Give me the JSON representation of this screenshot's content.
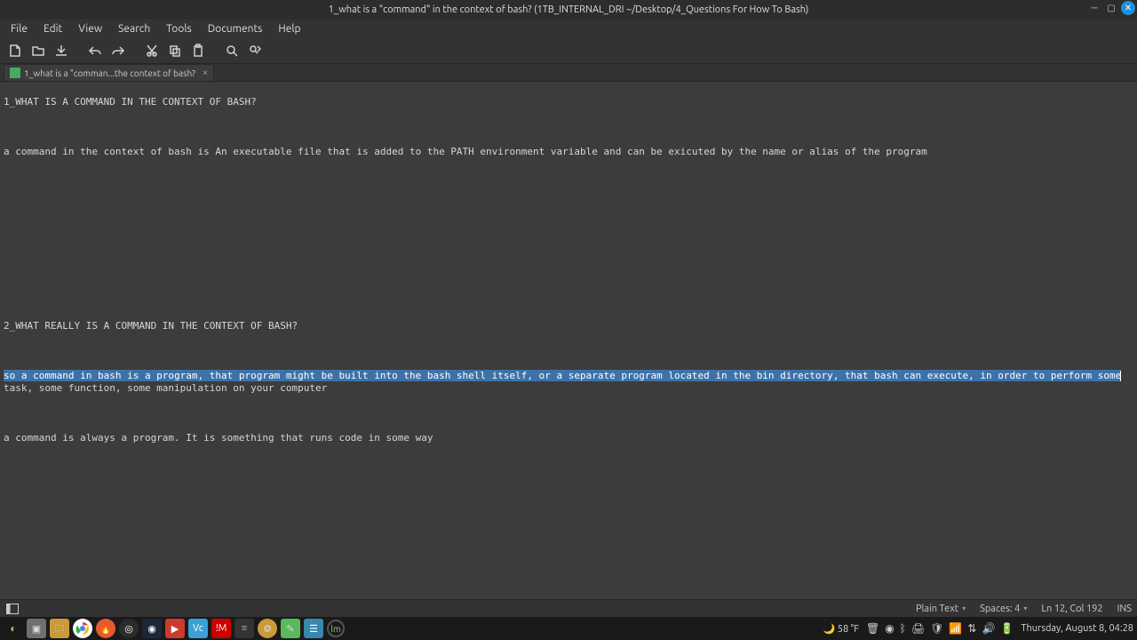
{
  "titlebar": {
    "title": "1_what is a \"command\" in the context of bash? (1TB_INTERNAL_DRI ~/Desktop/4_Questions For How To Bash)"
  },
  "menubar": {
    "items": [
      "File",
      "Edit",
      "View",
      "Search",
      "Tools",
      "Documents",
      "Help"
    ]
  },
  "toolbar_icons": [
    "new-file",
    "open-file",
    "save",
    "undo",
    "redo",
    "cut",
    "copy",
    "paste",
    "search",
    "find-replace"
  ],
  "tab": {
    "label": "1_what is a \"comman...the context of bash?"
  },
  "editor": {
    "line1": "1_WHAT IS A COMMAND IN THE CONTEXT OF BASH?",
    "line3": "a command in the context of bash is An executable file that is added to the PATH environment variable and can be exicuted by the name or alias of the program",
    "line10": "2_WHAT REALLY IS A COMMAND IN THE CONTEXT OF BASH?",
    "line12_selected": "so a command in bash is a program, that program might be built into the bash shell itself, or a separate program located in the bin directory, that bash can execute, in order to perform some",
    "line12_rest": "task, some function, some manipulation on your computer",
    "line14": "a command is always a program. It is something that runs code in some way"
  },
  "docstatus": {
    "syntax": "Plain Text",
    "spaces": "Spaces: 4",
    "cursor": "Ln 12, Col 192",
    "mode": "INS"
  },
  "taskbar": {
    "weather": "58 °F",
    "clock": "Thursday, August  8, 04:28"
  }
}
